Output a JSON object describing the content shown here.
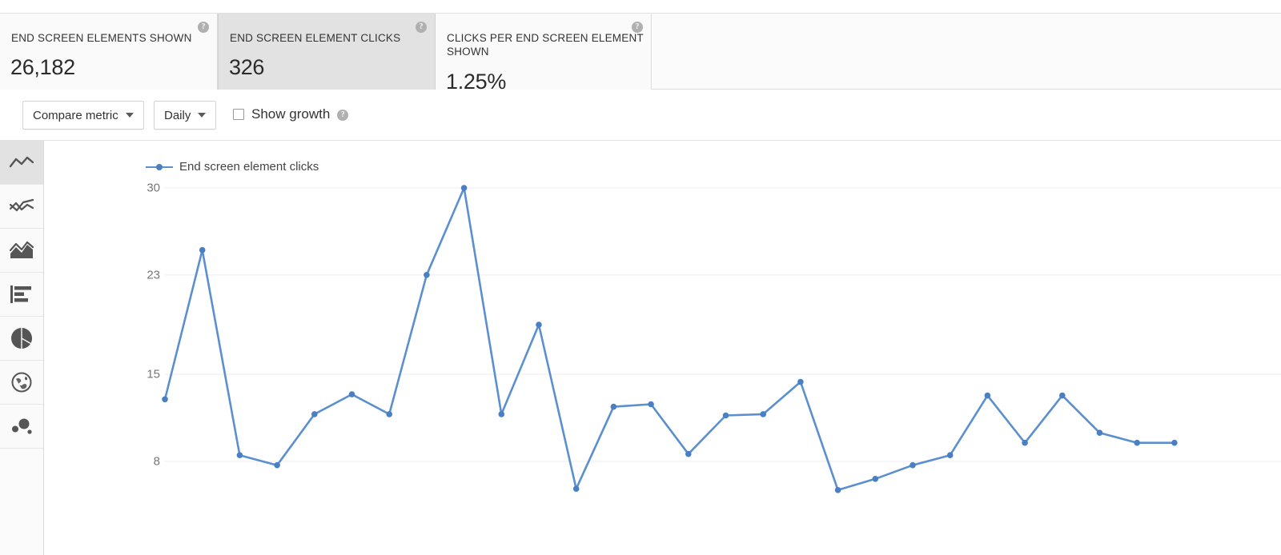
{
  "metrics": [
    {
      "id": "end-screen-elements-shown",
      "label": "END SCREEN ELEMENTS SHOWN",
      "value": "26,182",
      "selected": false,
      "help": "?"
    },
    {
      "id": "end-screen-element-clicks",
      "label": "END SCREEN ELEMENT CLICKS",
      "value": "326",
      "selected": true,
      "help": "?"
    },
    {
      "id": "clicks-per-end-screen-element-shown",
      "label": "CLICKS PER END SCREEN ELEMENT SHOWN",
      "value": "1.25%",
      "selected": false,
      "help": "?"
    }
  ],
  "toolbar": {
    "compare_metric_label": "Compare metric",
    "period_label": "Daily",
    "show_growth_label": "Show growth",
    "show_growth_checked": false,
    "show_growth_help": "?"
  },
  "chart_rail": {
    "items": [
      {
        "id": "line-chart",
        "name": "line-chart-icon",
        "active": true
      },
      {
        "id": "multi-line-chart",
        "name": "multi-line-chart-icon",
        "active": false
      },
      {
        "id": "area-chart",
        "name": "area-chart-icon",
        "active": false
      },
      {
        "id": "bar-chart",
        "name": "bar-chart-icon",
        "active": false
      },
      {
        "id": "pie-chart",
        "name": "pie-chart-icon",
        "active": false
      },
      {
        "id": "geography-map",
        "name": "globe-icon",
        "active": false
      },
      {
        "id": "bubble-chart",
        "name": "bubble-chart-icon",
        "active": false
      }
    ]
  },
  "chart_data": {
    "type": "line",
    "title": "",
    "subtitle": "",
    "xlabel": "",
    "ylabel": "",
    "legend": [
      "End screen element clicks"
    ],
    "legend_position": "top-left",
    "grid": true,
    "ylim": [
      0,
      30
    ],
    "yticks": [
      30,
      23,
      15,
      8
    ],
    "ytick_labels": [
      "30",
      "23",
      "15",
      "8"
    ],
    "line_color": "#5b8fd0",
    "marker_color": "#4a7fc4",
    "series": [
      {
        "name": "End screen element clicks",
        "values": [
          13,
          25,
          8.5,
          7.7,
          11.8,
          13.4,
          11.8,
          23,
          30,
          11.8,
          19,
          5.8,
          12.4,
          12.6,
          8.6,
          11.7,
          11.8,
          14.4,
          5.7,
          6.6,
          7.7,
          8.5,
          13.3,
          9.5,
          13.3,
          10.3,
          9.5,
          9.5
        ]
      }
    ],
    "x": [
      1,
      2,
      3,
      4,
      5,
      6,
      7,
      8,
      9,
      10,
      11,
      12,
      13,
      14,
      15,
      16,
      17,
      18,
      19,
      20,
      21,
      22,
      23,
      24,
      25,
      26,
      27,
      28
    ]
  }
}
